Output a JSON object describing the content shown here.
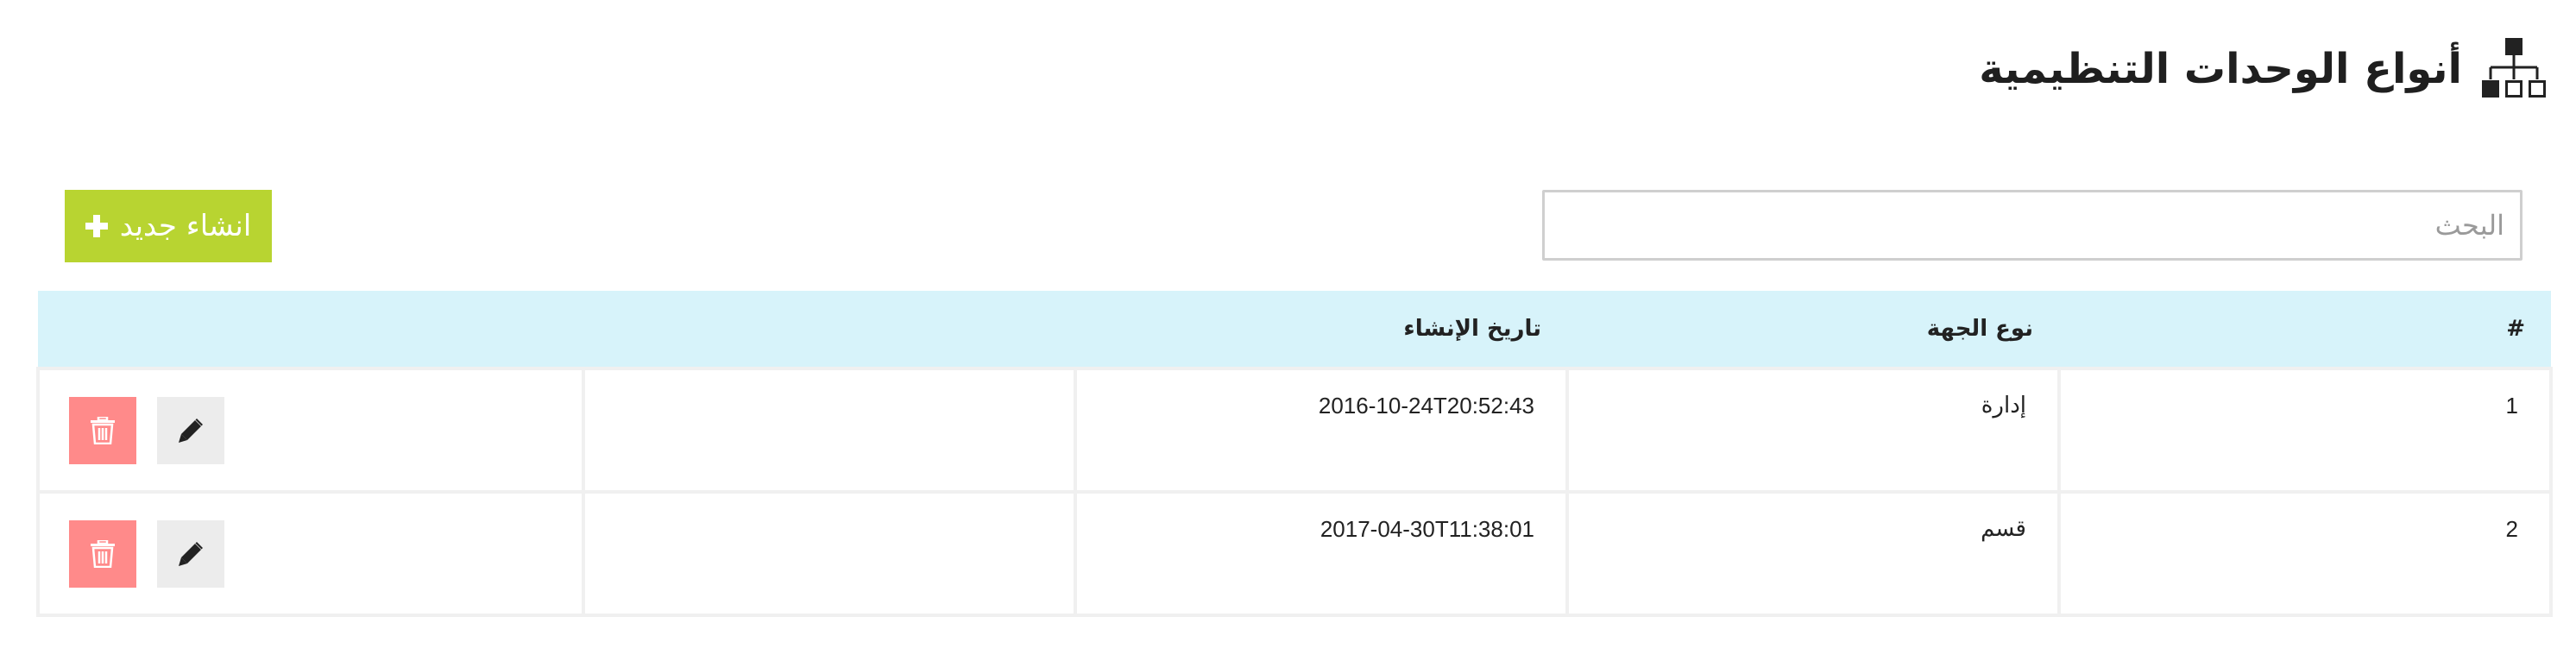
{
  "header": {
    "title": "أنواع الوحدات التنظيمية",
    "icon": "sitemap-icon"
  },
  "search": {
    "placeholder": "البحث",
    "value": ""
  },
  "toolbar": {
    "create_label": "انشاء جديد",
    "create_icon": "plus-icon",
    "create_color": "#b8d431"
  },
  "table": {
    "header_color": "#d7f3fa",
    "columns": [
      "#",
      "نوع الجهة",
      "تاريخ الإنشاء",
      "",
      ""
    ],
    "rows": [
      {
        "index": "1",
        "type": "إدارة",
        "created": "2016-10-24T20:52:43",
        "extra": ""
      },
      {
        "index": "2",
        "type": "قسم",
        "created": "2017-04-30T11:38:01",
        "extra": ""
      }
    ],
    "row_actions": [
      "edit-icon",
      "trash-icon"
    ],
    "delete_color": "#ff8a8a",
    "edit_color": "#ececec"
  }
}
